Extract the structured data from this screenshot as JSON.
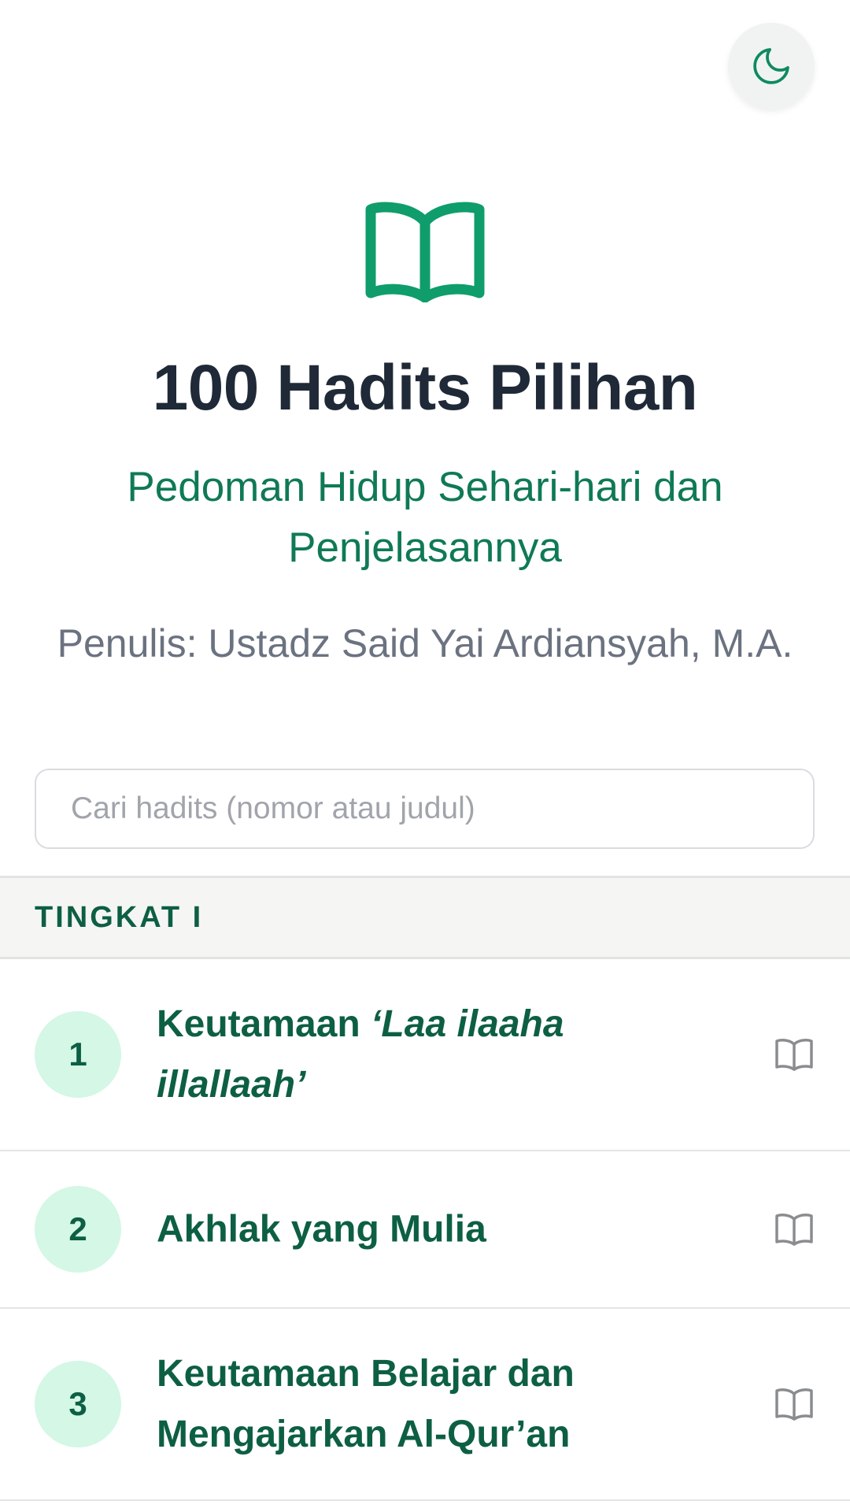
{
  "app": {
    "title": "100 Hadits Pilihan",
    "subtitle": "Pedoman Hidup Sehari-hari dan Penjelasannya",
    "author": "Penulis: Ustadz Said Yai Ardiansyah, M.A."
  },
  "icons": {
    "theme_toggle": "moon-icon",
    "hero": "book-open-icon",
    "row_action": "book-open-icon"
  },
  "colors": {
    "accent": "#0f9d6b",
    "primary_text": "#0d5f44",
    "title": "#1f2937",
    "muted": "#6b7280",
    "badge_bg": "#d4f7e6"
  },
  "search": {
    "placeholder": "Cari hadits (nomor atau judul)",
    "value": ""
  },
  "section": {
    "label": "TINGKAT I"
  },
  "hadiths": [
    {
      "number": "1",
      "title_prefix": "Keutamaan ",
      "title_italic": "‘Laa ilaaha illallaah’"
    },
    {
      "number": "2",
      "title": "Akhlak yang Mulia"
    },
    {
      "number": "3",
      "title": "Keutamaan Belajar dan Mengajarkan Al-Qur’an"
    }
  ]
}
